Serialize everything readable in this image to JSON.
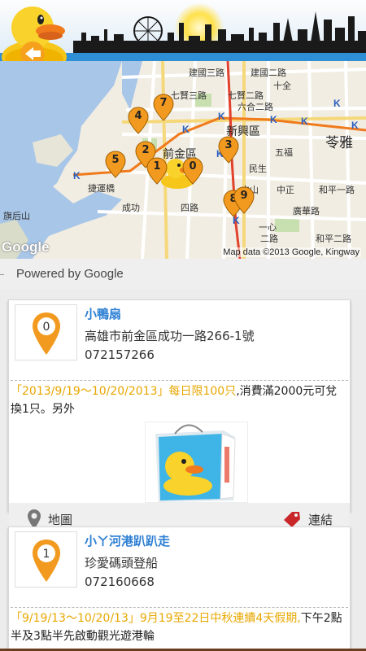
{
  "map": {
    "credit": "Map data ©2013 Google, Kingway",
    "logo": "Google",
    "labels": {
      "district_xinxing": "新興區",
      "district_qianjin": "前金區",
      "district_lingya": "苓雅",
      "road_jianguo3": "建國三路",
      "road_jianguo2": "建國二路",
      "road_qixian2": "七賢二路",
      "road_qixian3": "七賢三路",
      "road_liuhe2": "六合二路",
      "road_wufu": "五福",
      "road_jiebo": "捷運橋",
      "road_heping1": "和平一路",
      "road_guanghua": "廣華路",
      "road_qufeng": "旗后山",
      "road_zhongzheng": "中正",
      "road_heping2": "和平二路",
      "road_chenggong": "成功",
      "road_fourth": "四路",
      "road_zhongshan": "中山",
      "road_minsheng": "民生",
      "road_yi": "一心",
      "road_er": "二路",
      "road_shiquan": "十全"
    },
    "pins": [
      "7",
      "4",
      "2",
      "1",
      "0",
      "3",
      "5",
      "8",
      "9"
    ]
  },
  "powered_by": "Powered by Google",
  "cards": [
    {
      "index": "0",
      "title": "小鴨扇",
      "address": "高雄市前金區成功一路266-1號",
      "phone": "072157266",
      "promo_highlight": "「2013/9/19～10/20/2013」每日限100只",
      "promo_rest": ",消費滿2000元可兌換1只。另外",
      "map_label": "地圖",
      "link_label": "連結"
    },
    {
      "index": "1",
      "title": "小ㄚ河港趴趴走",
      "address": "珍愛碼頭登船",
      "phone": "072160668",
      "promo_highlight": "「9/19/13～10/20/13」9月19至22日中秋連續4天假期,",
      "promo_rest": "下午2點半及3點半先啟動觀光遊港輪"
    }
  ],
  "colors": {
    "accent_blue": "#2d7fd3",
    "pin_orange": "#f29a1f",
    "highlight_yellow": "#e8a700",
    "header_stripe": "#2f8fd6"
  },
  "icons": {
    "back": "back-arrow-icon",
    "map": "map-pin-icon",
    "link": "tag-icon",
    "marker": "location-marker-icon"
  }
}
